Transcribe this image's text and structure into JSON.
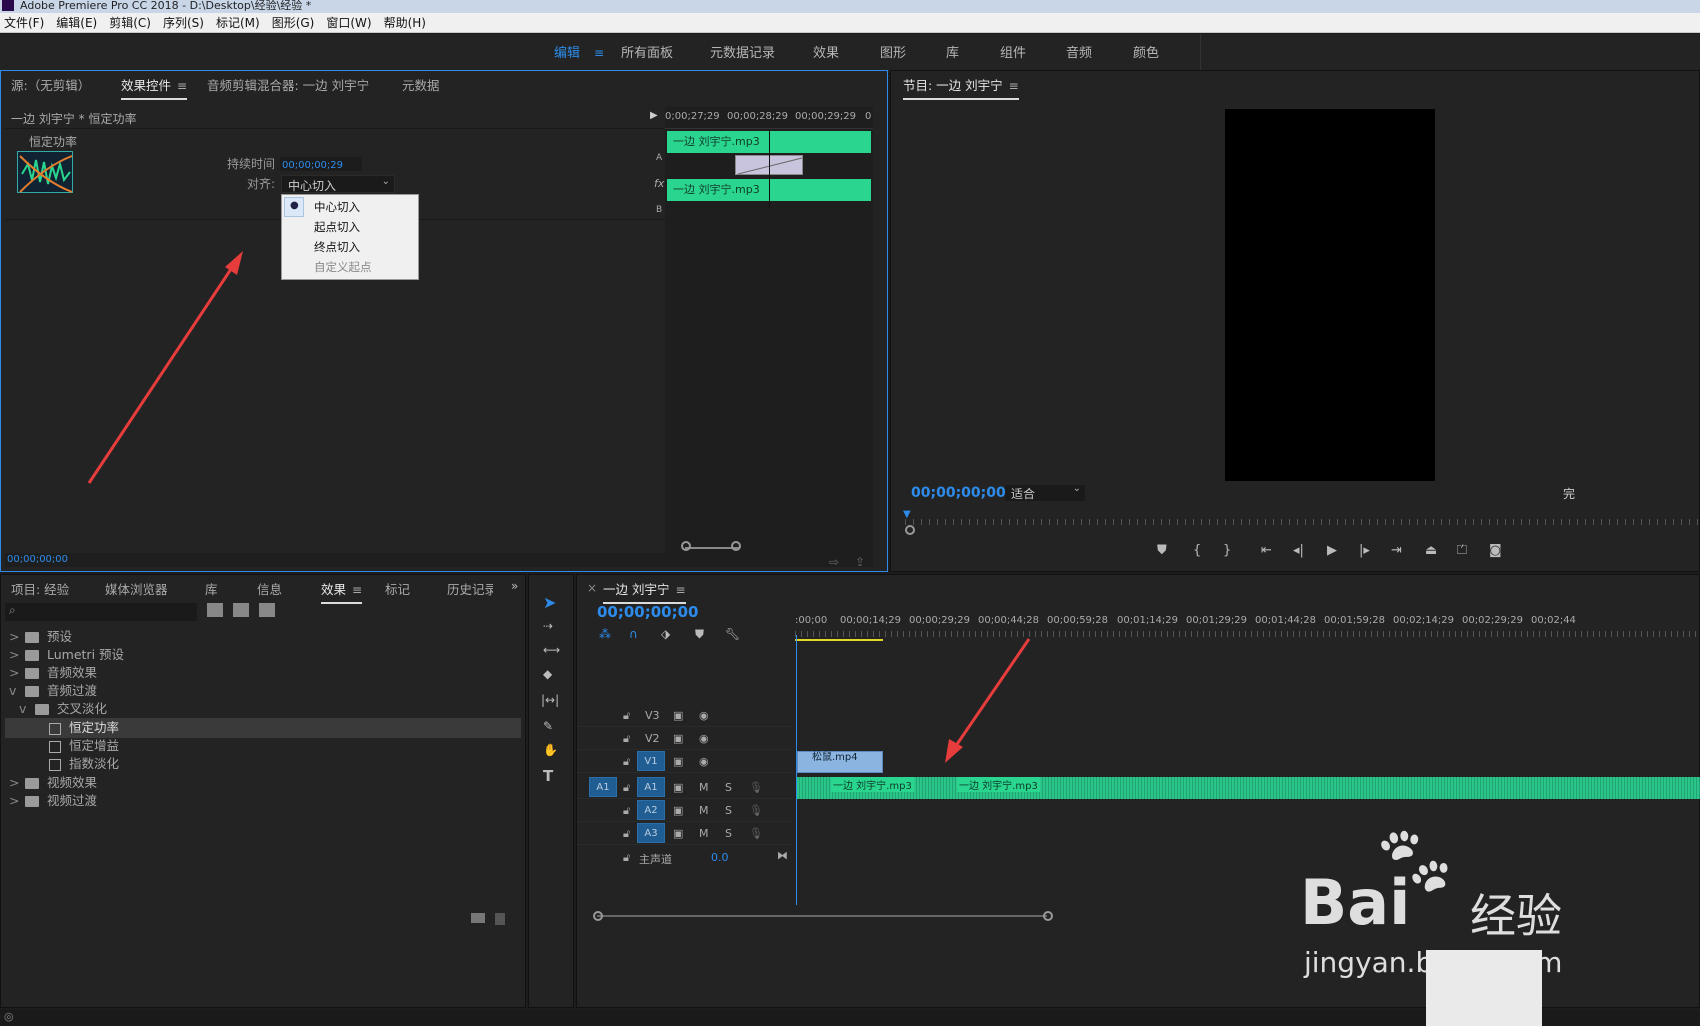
{
  "app": {
    "title": "Adobe Premiere Pro CC 2018 - D:\\Desktop\\经验\\经验 *"
  },
  "menu": [
    "文件(F)",
    "编辑(E)",
    "剪辑(C)",
    "序列(S)",
    "标记(M)",
    "图形(G)",
    "窗口(W)",
    "帮助(H)"
  ],
  "workspaces": [
    {
      "label": "编辑",
      "active": true
    },
    {
      "label": "所有面板"
    },
    {
      "label": "元数据记录"
    },
    {
      "label": "效果"
    },
    {
      "label": "图形"
    },
    {
      "label": "库"
    },
    {
      "label": "组件"
    },
    {
      "label": "音频"
    },
    {
      "label": "颜色"
    }
  ],
  "source_panel": {
    "tabs": [
      "源:（无剪辑）",
      "效果控件",
      "音频剪辑混合器: 一边 刘宇宁",
      "元数据"
    ],
    "header": "一边 刘宇宁 * 恒定功率",
    "effect_name": "恒定功率",
    "duration_label": "持续时间",
    "duration_value": "00;00;00;29",
    "align_label": "对齐:",
    "align_value": "中心切入",
    "dropdown": [
      "中心切入",
      "起点切入",
      "终点切入",
      "自定义起点"
    ],
    "ruler": [
      "0;00;27;29",
      "00;00;28;29",
      "00;00;29;29",
      "0"
    ],
    "clip_a": "一边 刘宇宁.mp3",
    "clip_b": "一边 刘宇宁.mp3",
    "track_a": "A",
    "track_b": "B",
    "fx": "fx",
    "timecode": "00;00;00;00"
  },
  "program_panel": {
    "title": "节目: 一边 刘宇宁",
    "timecode": "00;00;00;00",
    "fit": "适合",
    "right_edge": "完"
  },
  "project_panel": {
    "tabs": [
      "项目: 经验",
      "媒体浏览器",
      "库",
      "信息",
      "效果",
      "标记",
      "历史记录"
    ],
    "tree": [
      {
        "label": "预设",
        "level": 0,
        "caret": ">"
      },
      {
        "label": "Lumetri 预设",
        "level": 0,
        "caret": ">"
      },
      {
        "label": "音频效果",
        "level": 0,
        "caret": ">"
      },
      {
        "label": "音频过渡",
        "level": 0,
        "caret": "v"
      },
      {
        "label": "交叉淡化",
        "level": 1,
        "caret": "v"
      },
      {
        "label": "恒定功率",
        "level": 2,
        "selected": true
      },
      {
        "label": "恒定增益",
        "level": 2
      },
      {
        "label": "指数淡化",
        "level": 2
      },
      {
        "label": "视频效果",
        "level": 0,
        "caret": ">"
      },
      {
        "label": "视频过渡",
        "level": 0,
        "caret": ">"
      }
    ]
  },
  "timeline": {
    "title": "一边 刘宇宁",
    "timecode": "00;00;00;00",
    "ruler": [
      ":00;00",
      "00;00;14;29",
      "00;00;29;29",
      "00;00;44;28",
      "00;00;59;28",
      "00;01;14;29",
      "00;01;29;29",
      "00;01;44;28",
      "00;01;59;28",
      "00;02;14;29",
      "00;02;29;29",
      "00;02;44"
    ],
    "tracks": [
      "V3",
      "V2",
      "V1",
      "A1",
      "A2",
      "A3"
    ],
    "master_label": "主声道",
    "master_value": "0.0",
    "video_clip": "松鼠.mp4",
    "audio_clip_1": "一边 刘宇宁.mp3",
    "audio_clip_2": "一边 刘宇宁.mp3",
    "m": "M",
    "s": "S"
  },
  "watermark": {
    "brand": "Bai",
    "cn": "经验",
    "url": "jingyan.baidu.com"
  },
  "colors": {
    "accent": "#2d8ceb",
    "clip": "#2ad590",
    "arrow": "#e63c3c"
  }
}
